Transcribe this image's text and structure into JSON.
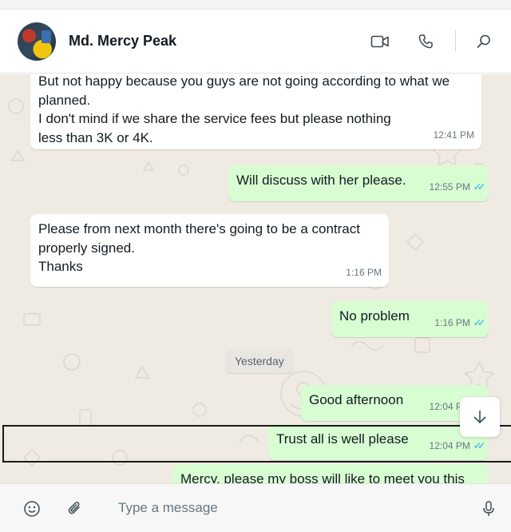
{
  "header": {
    "contact_name": "Md. Mercy Peak",
    "icons": [
      "video-call-icon",
      "voice-call-icon",
      "search-icon"
    ]
  },
  "messages": [
    {
      "direction": "in",
      "text": "But not happy because you guys are not going according to what we\nplanned.\nI don't mind if we share the service fees but please nothing\nless than 3K or 4K.",
      "time": "12:41 PM"
    },
    {
      "direction": "out",
      "text": "Will discuss with her please.",
      "time": "12:55 PM",
      "read": true
    },
    {
      "direction": "in",
      "text": "Please from next month there's going to be a contract\nproperly signed.\nThanks",
      "time": "1:16 PM"
    },
    {
      "direction": "out",
      "text": "No problem",
      "time": "1:16 PM",
      "read": true
    },
    {
      "direction": "out",
      "text": "Good afternoon",
      "time": "12:04 PM",
      "read": true
    },
    {
      "direction": "out",
      "text": "Trust all is well please",
      "time": "12:04 PM",
      "read": true
    },
    {
      "direction": "out",
      "text": "Mercy, please my boss will like to meet you this",
      "time": ""
    }
  ],
  "date_separator": "Yesterday",
  "composer": {
    "placeholder": "Type a message",
    "icons": [
      "emoji-icon",
      "attach-icon",
      "microphone-icon"
    ]
  },
  "colors": {
    "incoming_bubble": "#ffffff",
    "outgoing_bubble": "#d9fdd3",
    "read_ticks": "#53bdeb",
    "chat_background": "#efeae2"
  }
}
